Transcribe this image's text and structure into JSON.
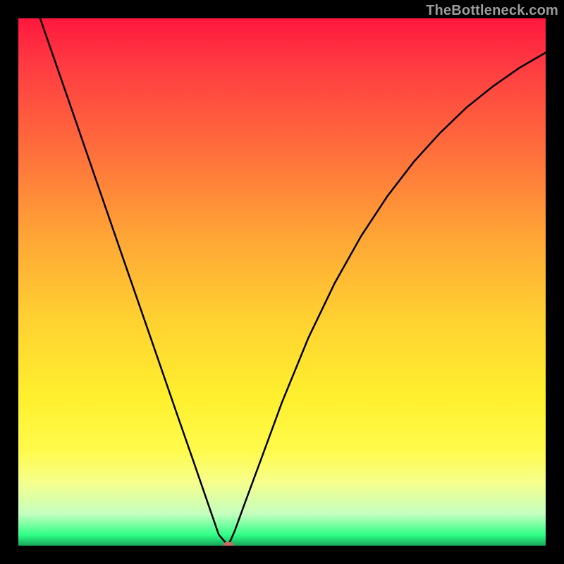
{
  "watermark": {
    "text": "TheBottleneck.com"
  },
  "chart_data": {
    "type": "line",
    "title": "",
    "xlabel": "",
    "ylabel": "",
    "xlim": [
      0,
      100
    ],
    "ylim": [
      0,
      100
    ],
    "series": [
      {
        "name": "bottleneck-curve",
        "type": "line",
        "x": [
          0,
          5,
          10,
          15,
          20,
          25,
          30,
          33,
          36,
          38,
          39.8,
          41,
          43,
          46,
          50,
          55,
          60,
          65,
          70,
          75,
          80,
          85,
          90,
          95,
          100
        ],
        "y": [
          112,
          97.5,
          83.1,
          68.6,
          54.1,
          39.7,
          25.2,
          16.6,
          7.9,
          2.1,
          0,
          2.7,
          8.2,
          16.3,
          27.2,
          39.4,
          49.8,
          58.7,
          66.3,
          72.8,
          78.3,
          83.1,
          87.1,
          90.6,
          93.5
        ]
      }
    ],
    "marker": {
      "x": 39.8,
      "y": 0,
      "color": "#c76b66"
    },
    "background_gradient": {
      "stops": [
        {
          "pct": 0,
          "color": "#ff173e"
        },
        {
          "pct": 8,
          "color": "#ff3842"
        },
        {
          "pct": 25,
          "color": "#ff6e3c"
        },
        {
          "pct": 41,
          "color": "#ffa436"
        },
        {
          "pct": 57,
          "color": "#ffd131"
        },
        {
          "pct": 72,
          "color": "#fff02e"
        },
        {
          "pct": 82,
          "color": "#fffb4c"
        },
        {
          "pct": 88,
          "color": "#f6ff8c"
        },
        {
          "pct": 94,
          "color": "#c4ffbf"
        },
        {
          "pct": 98,
          "color": "#2fff86"
        },
        {
          "pct": 100,
          "color": "#17a658"
        }
      ]
    }
  }
}
